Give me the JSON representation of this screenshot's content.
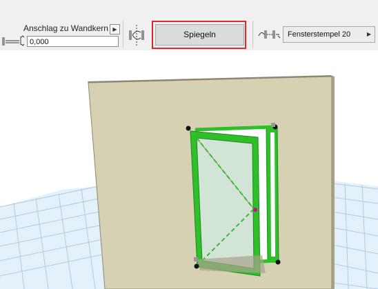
{
  "toolbar": {
    "reveal_label": "Anschlag zu Wandkern",
    "reveal_value": "0,000",
    "mirror_label": "Spiegeln",
    "stamp_label": "Fensterstempel 20",
    "accent_color": "#e0262a"
  },
  "icons": [
    "reveal-offset-icon",
    "flip-swing-icon",
    "stamp-offset-icon",
    "chevron-right-icon"
  ]
}
